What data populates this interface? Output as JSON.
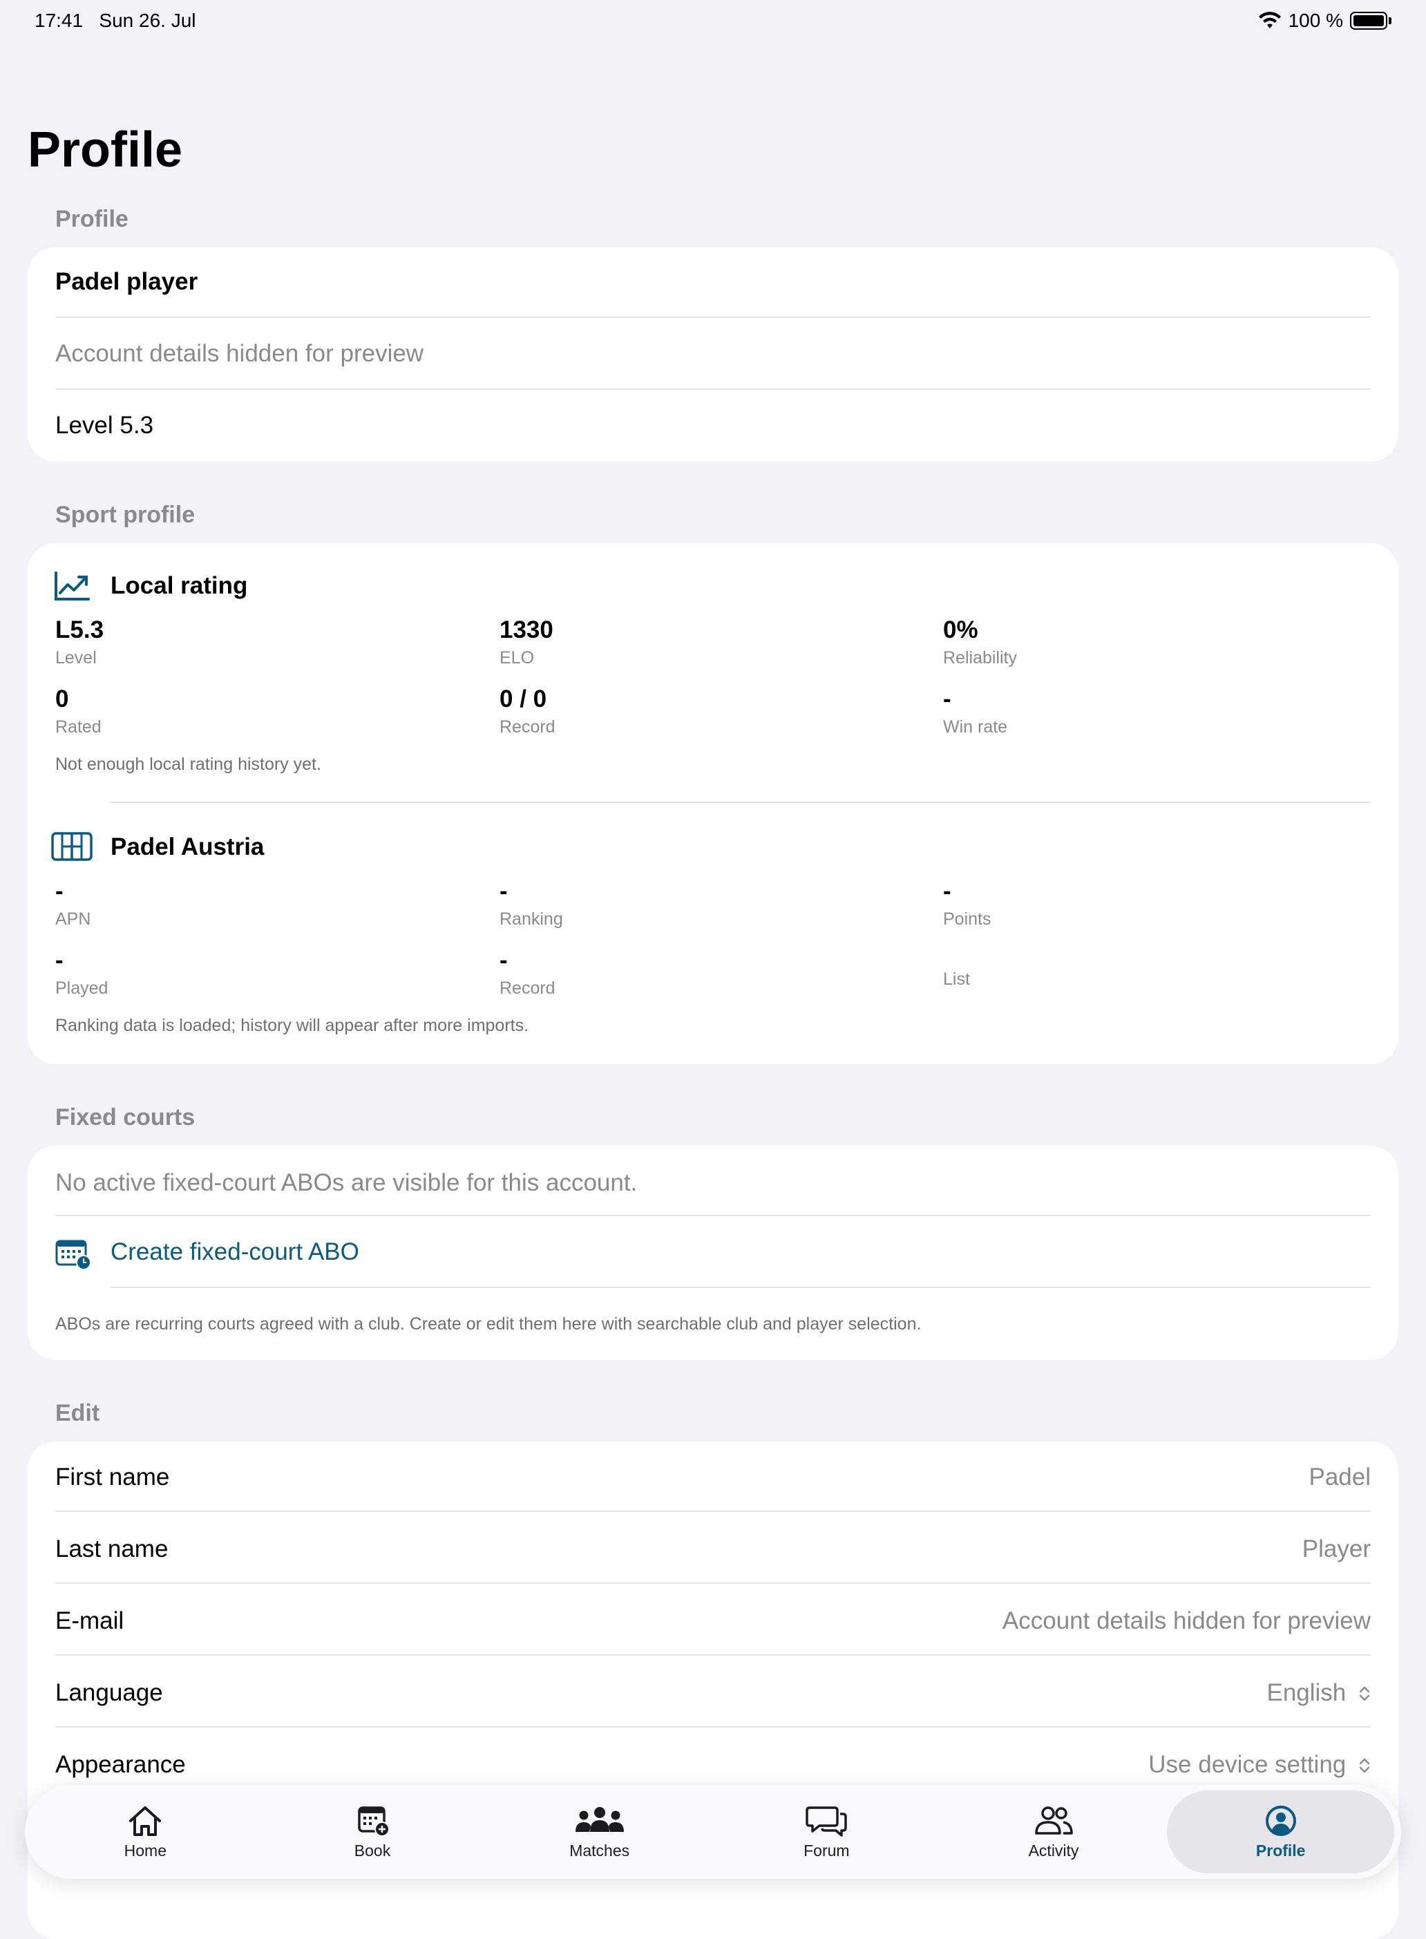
{
  "status_bar": {
    "time": "17:41",
    "date": "Sun 26. Jul",
    "battery": "100 %"
  },
  "page_title": "Profile",
  "profile": {
    "header": "Profile",
    "name": "Padel player",
    "account_details": "Account details hidden for preview",
    "level": "Level 5.3"
  },
  "sport_profile": {
    "header": "Sport profile",
    "local_rating": {
      "title": "Local rating",
      "stats": [
        {
          "value": "L5.3",
          "label": "Level"
        },
        {
          "value": "1330",
          "label": "ELO"
        },
        {
          "value": "0%",
          "label": "Reliability"
        },
        {
          "value": "0",
          "label": "Rated"
        },
        {
          "value": "0 / 0",
          "label": "Record"
        },
        {
          "value": "-",
          "label": "Win rate"
        }
      ],
      "note": "Not enough local rating history yet."
    },
    "padel_austria": {
      "title": "Padel Austria",
      "stats": [
        {
          "value": "-",
          "label": "APN"
        },
        {
          "value": "-",
          "label": "Ranking"
        },
        {
          "value": "-",
          "label": "Points"
        },
        {
          "value": "-",
          "label": "Played"
        },
        {
          "value": "-",
          "label": "Record"
        },
        {
          "value": "",
          "label": "List"
        }
      ],
      "note": "Ranking data is loaded; history will appear after more imports."
    }
  },
  "fixed_courts": {
    "header": "Fixed courts",
    "empty_text": "No active fixed-court ABOs are visible for this account.",
    "create_label": "Create fixed-court ABO",
    "footnote": "ABOs are recurring courts agreed with a club. Create or edit them here with searchable club and player selection."
  },
  "edit": {
    "header": "Edit",
    "rows": [
      {
        "label": "First name",
        "value": "Padel"
      },
      {
        "label": "Last name",
        "value": "Player"
      },
      {
        "label": "E-mail",
        "value": "Account details hidden for preview"
      },
      {
        "label": "Language",
        "value": "English"
      },
      {
        "label": "Appearance",
        "value": "Use device setting"
      }
    ]
  },
  "tab_bar": {
    "tabs": [
      {
        "label": "Home",
        "icon": "house-icon"
      },
      {
        "label": "Book",
        "icon": "calendar-add-icon"
      },
      {
        "label": "Matches",
        "icon": "people-icon"
      },
      {
        "label": "Forum",
        "icon": "chat-bubbles-icon"
      },
      {
        "label": "Activity",
        "icon": "person-pair-icon"
      },
      {
        "label": "Profile",
        "icon": "person-circle-icon"
      }
    ],
    "active": "Profile"
  },
  "colors": {
    "accent": "#0b5a84",
    "background": "#f2f2f7",
    "secondary_text": "#8a8a8e"
  }
}
